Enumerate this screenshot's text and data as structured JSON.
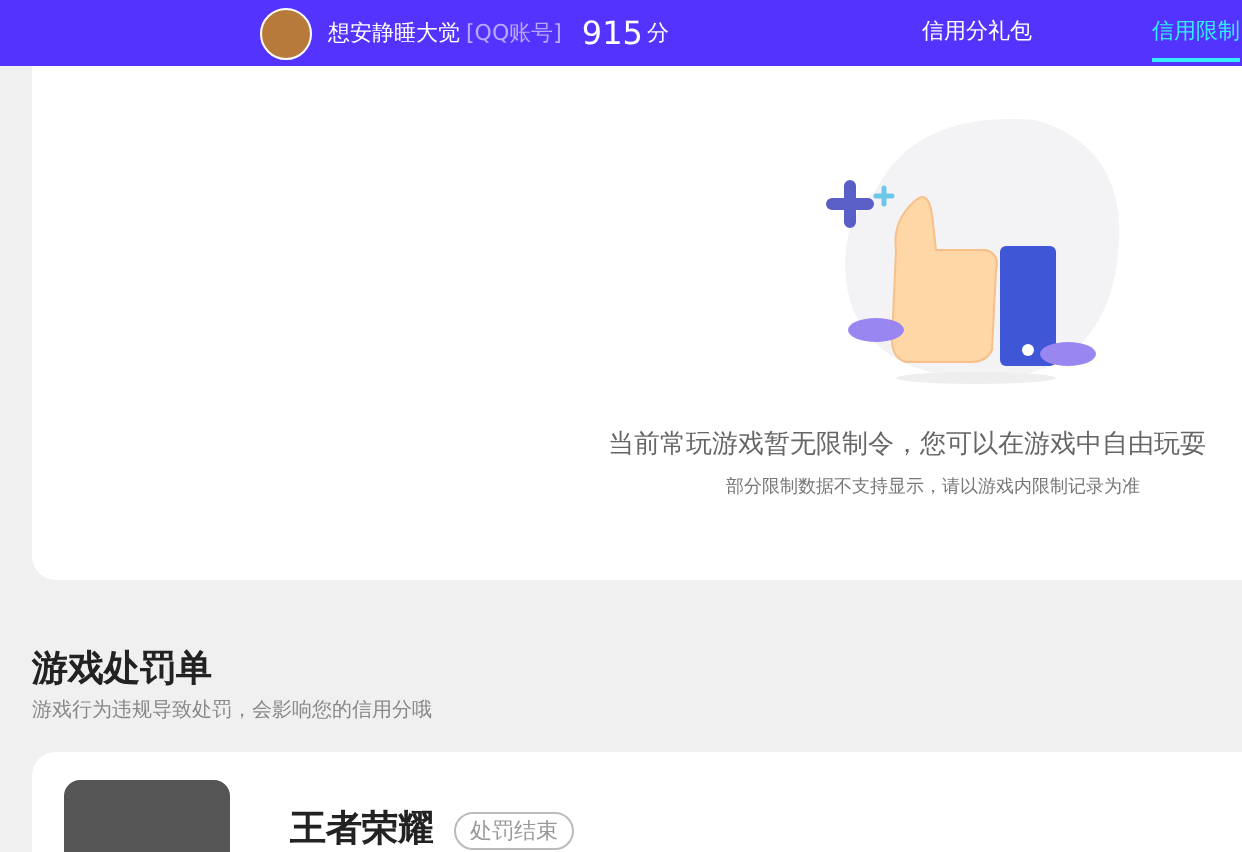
{
  "header": {
    "user_name": "想安静睡大觉",
    "account_type": "[QQ账号]",
    "score": "915",
    "score_unit": "分",
    "tabs": [
      {
        "label": "信用分礼包",
        "selected": false
      },
      {
        "label": "信用限制",
        "selected": true
      }
    ]
  },
  "restriction_card": {
    "message": "当前常玩游戏暂无限制令，您可以在游戏中自由玩耍",
    "note": "部分限制数据不支持显示，请以游戏内限制记录为准"
  },
  "penalty_section": {
    "title": "游戏处罚单",
    "subtitle": "游戏行为违规导致处罚，会影响您的信用分哦",
    "items": [
      {
        "game": "王者荣耀",
        "status": "处罚结束"
      }
    ]
  }
}
